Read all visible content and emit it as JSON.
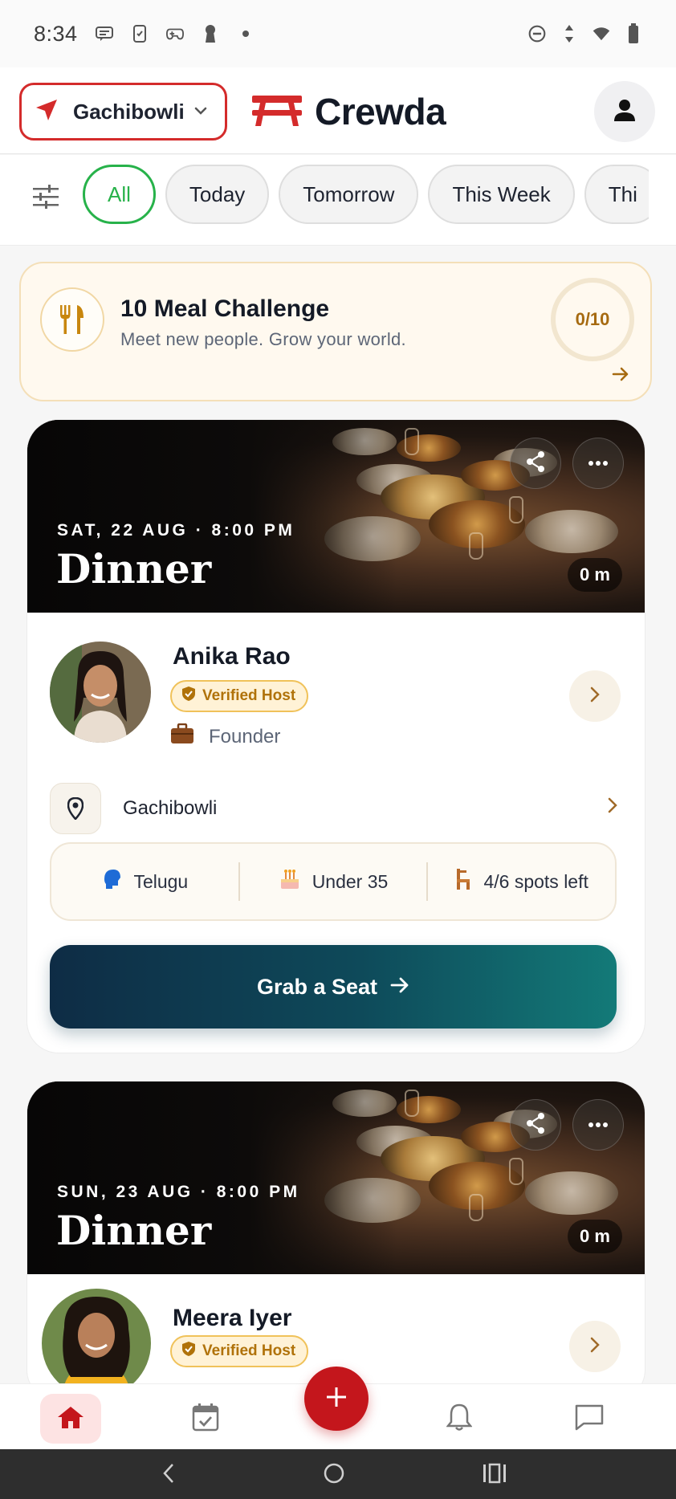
{
  "status_bar": {
    "time": "8:34"
  },
  "header": {
    "location": "Gachibowli",
    "brand": "Crewda",
    "colors": {
      "accent": "#d42b2b",
      "brand_icon": "#d42b2b"
    }
  },
  "filters": {
    "chips": [
      "All",
      "Today",
      "Tomorrow",
      "This Week",
      "Thi"
    ],
    "active_index": 0
  },
  "challenge": {
    "title": "10 Meal Challenge",
    "subtitle": "Meet new people. Grow your world.",
    "progress_label": "0/10",
    "progress": 0
  },
  "events": [
    {
      "date": "SAT, 22 AUG · 8:00 PM",
      "title": "Dinner",
      "distance": "0 m",
      "host": {
        "name": "Anika Rao",
        "badge": "Verified Host",
        "role": "Founder"
      },
      "location": "Gachibowli",
      "stats": {
        "language": "Telugu",
        "age": "Under 35",
        "spots": "4/6 spots left"
      },
      "cta": "Grab a Seat"
    },
    {
      "date": "SUN, 23 AUG · 8:00 PM",
      "title": "Dinner",
      "distance": "0 m",
      "host": {
        "name": "Meera Iyer",
        "badge": "Verified Host"
      }
    }
  ],
  "bottom_nav": {
    "items": [
      "home-icon",
      "calendar-icon",
      "add-icon",
      "bell-icon",
      "chat-icon"
    ],
    "active": "home-icon"
  }
}
